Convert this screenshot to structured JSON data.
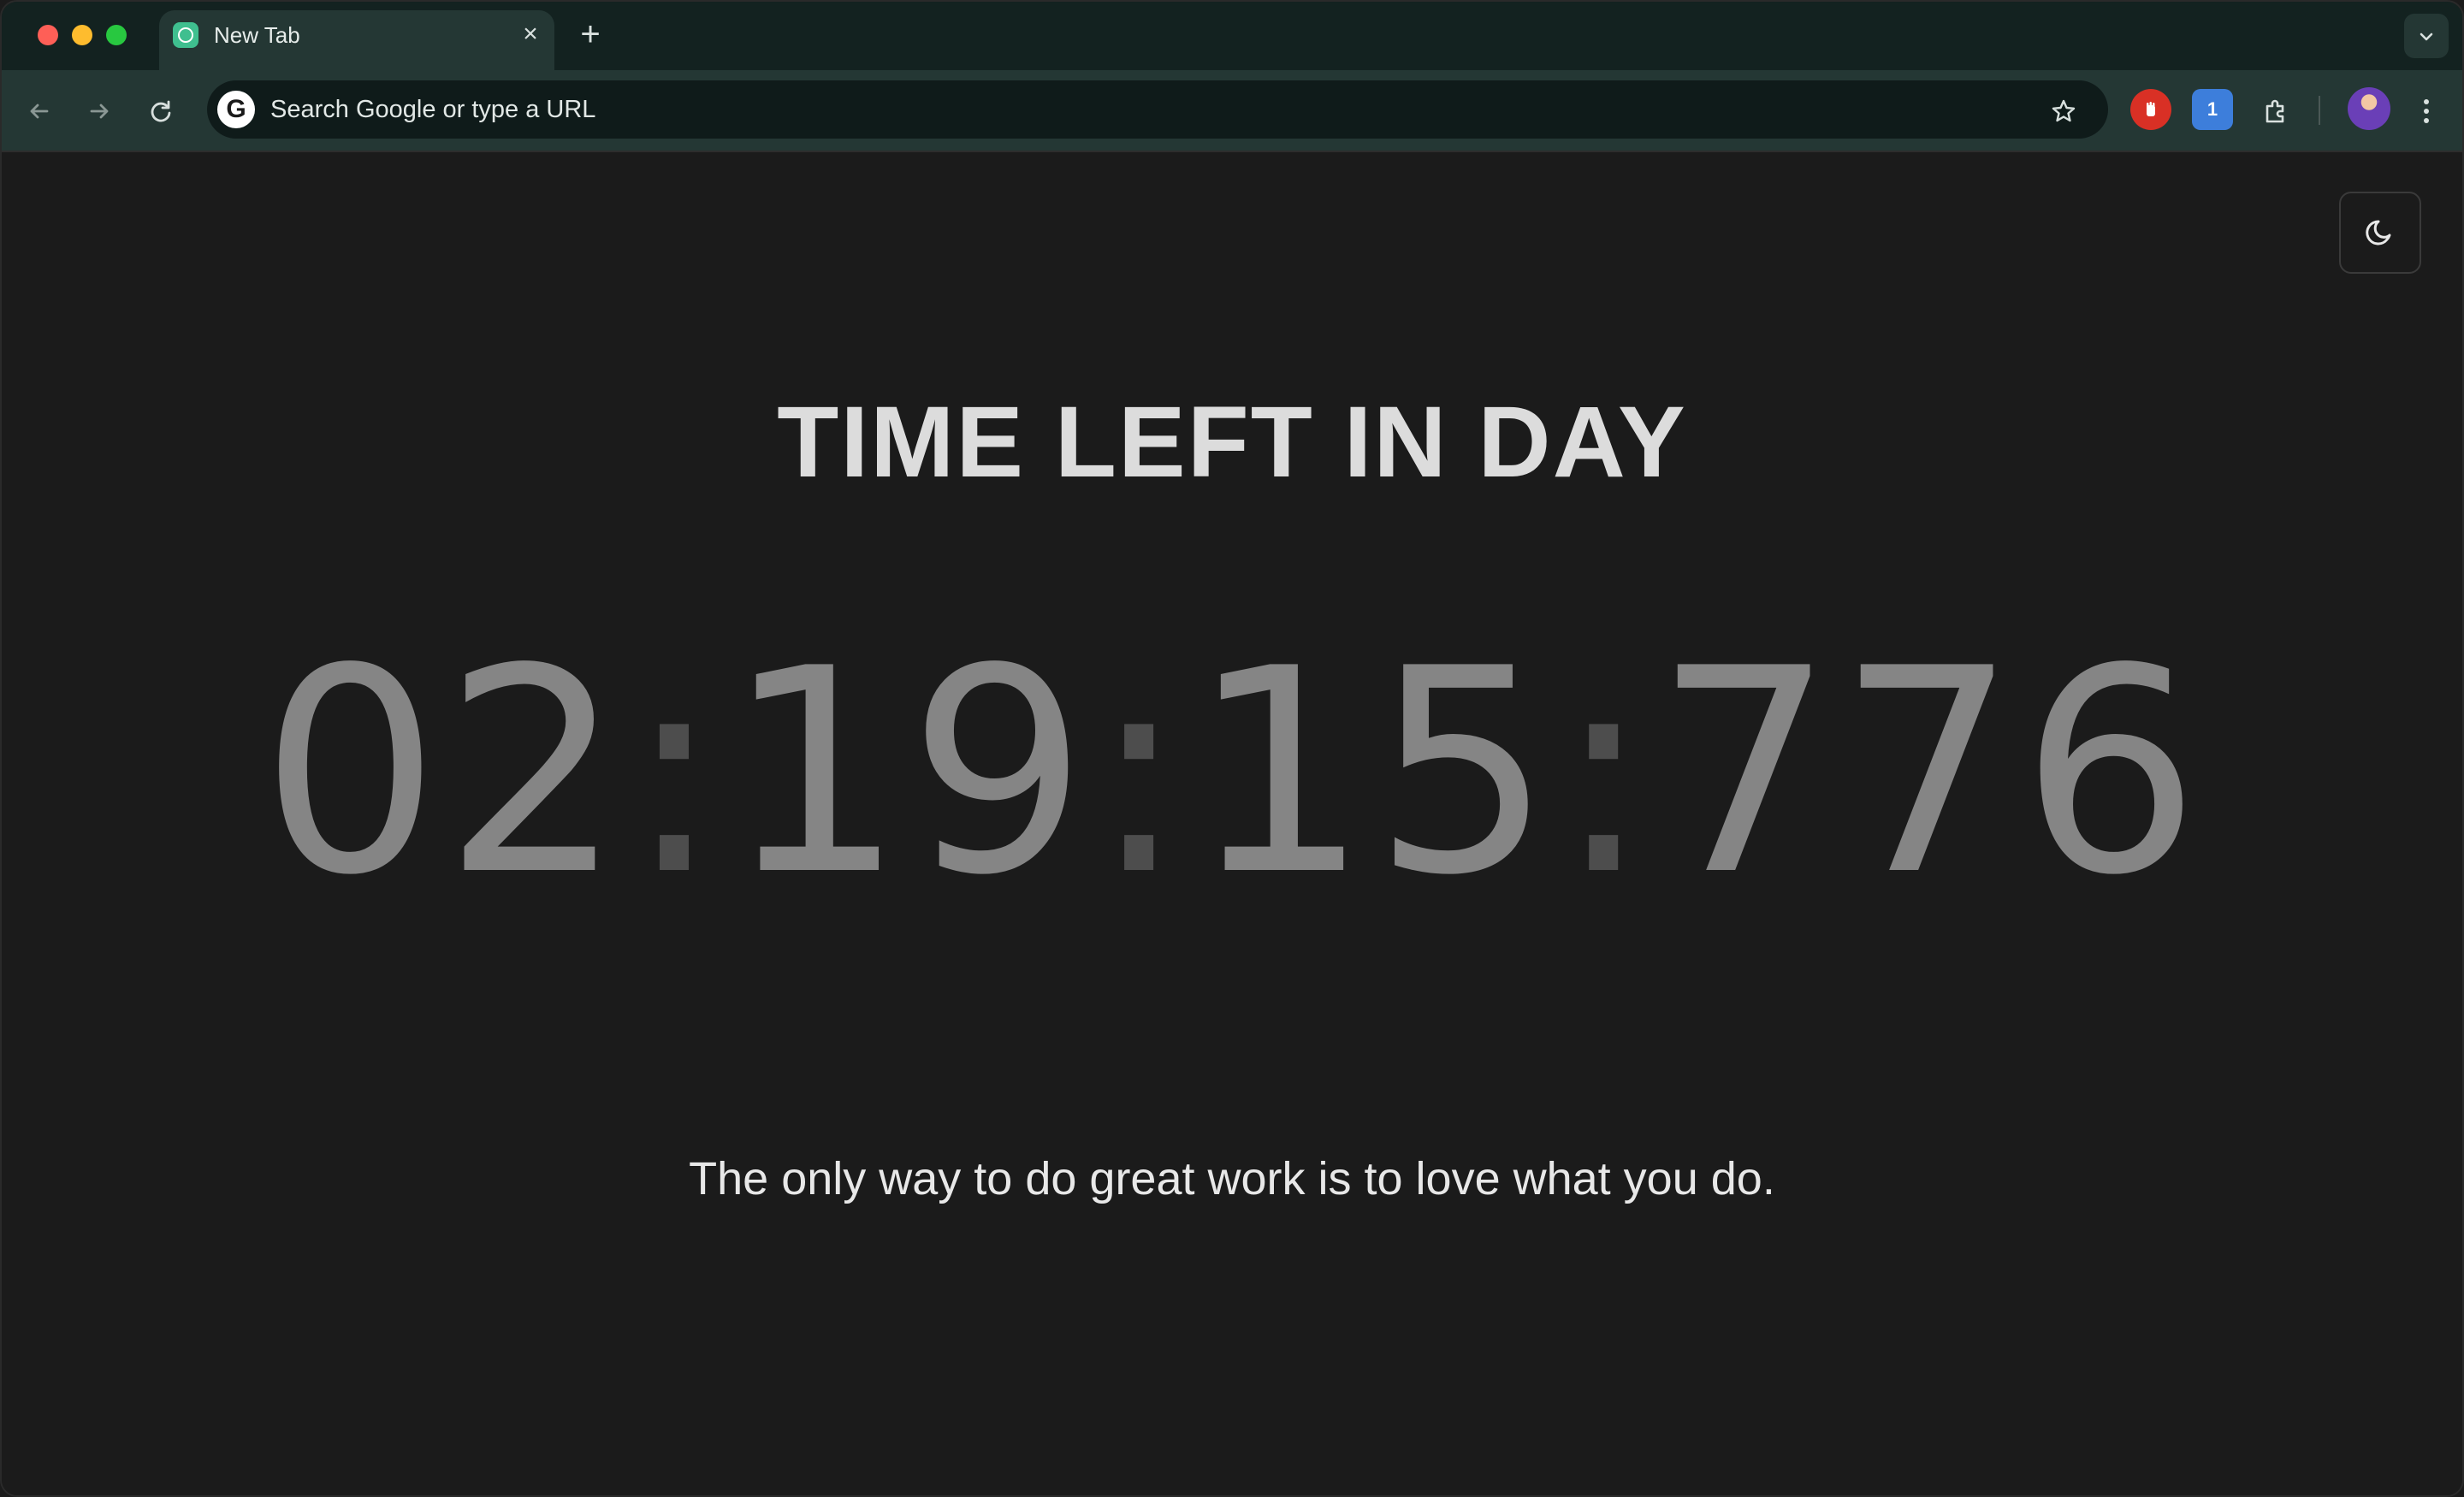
{
  "browser": {
    "tabs": [
      {
        "title": "New Tab",
        "favicon": "clock-icon",
        "favicon_color": "#3fbf8f"
      }
    ],
    "new_tab_label": "+",
    "tab_close_label": "×",
    "omnibox": {
      "placeholder": "Search Google or type a URL",
      "icon": "google-g-icon"
    },
    "extensions": [
      "red-hand-extension-icon",
      "bitwarden-extension-icon",
      "puzzle-extensions-icon"
    ],
    "colors": {
      "tabstrip_bg": "#132220",
      "toolbar_bg": "#243734",
      "omnibox_bg": "#0f1b1a"
    }
  },
  "page": {
    "title": "TIME LEFT IN DAY",
    "timer": {
      "hours": "02",
      "minutes": "19",
      "seconds": "15",
      "milliseconds": "776"
    },
    "quote": "The only way to do great work is to love what you do.",
    "theme_toggle_icon": "moon-icon",
    "colors": {
      "background": "#1b1b1b",
      "title": "#dcdcdc",
      "timer_digits": "#858585",
      "timer_colons": "#4d4d4d",
      "quote": "#e8e8e8"
    }
  }
}
